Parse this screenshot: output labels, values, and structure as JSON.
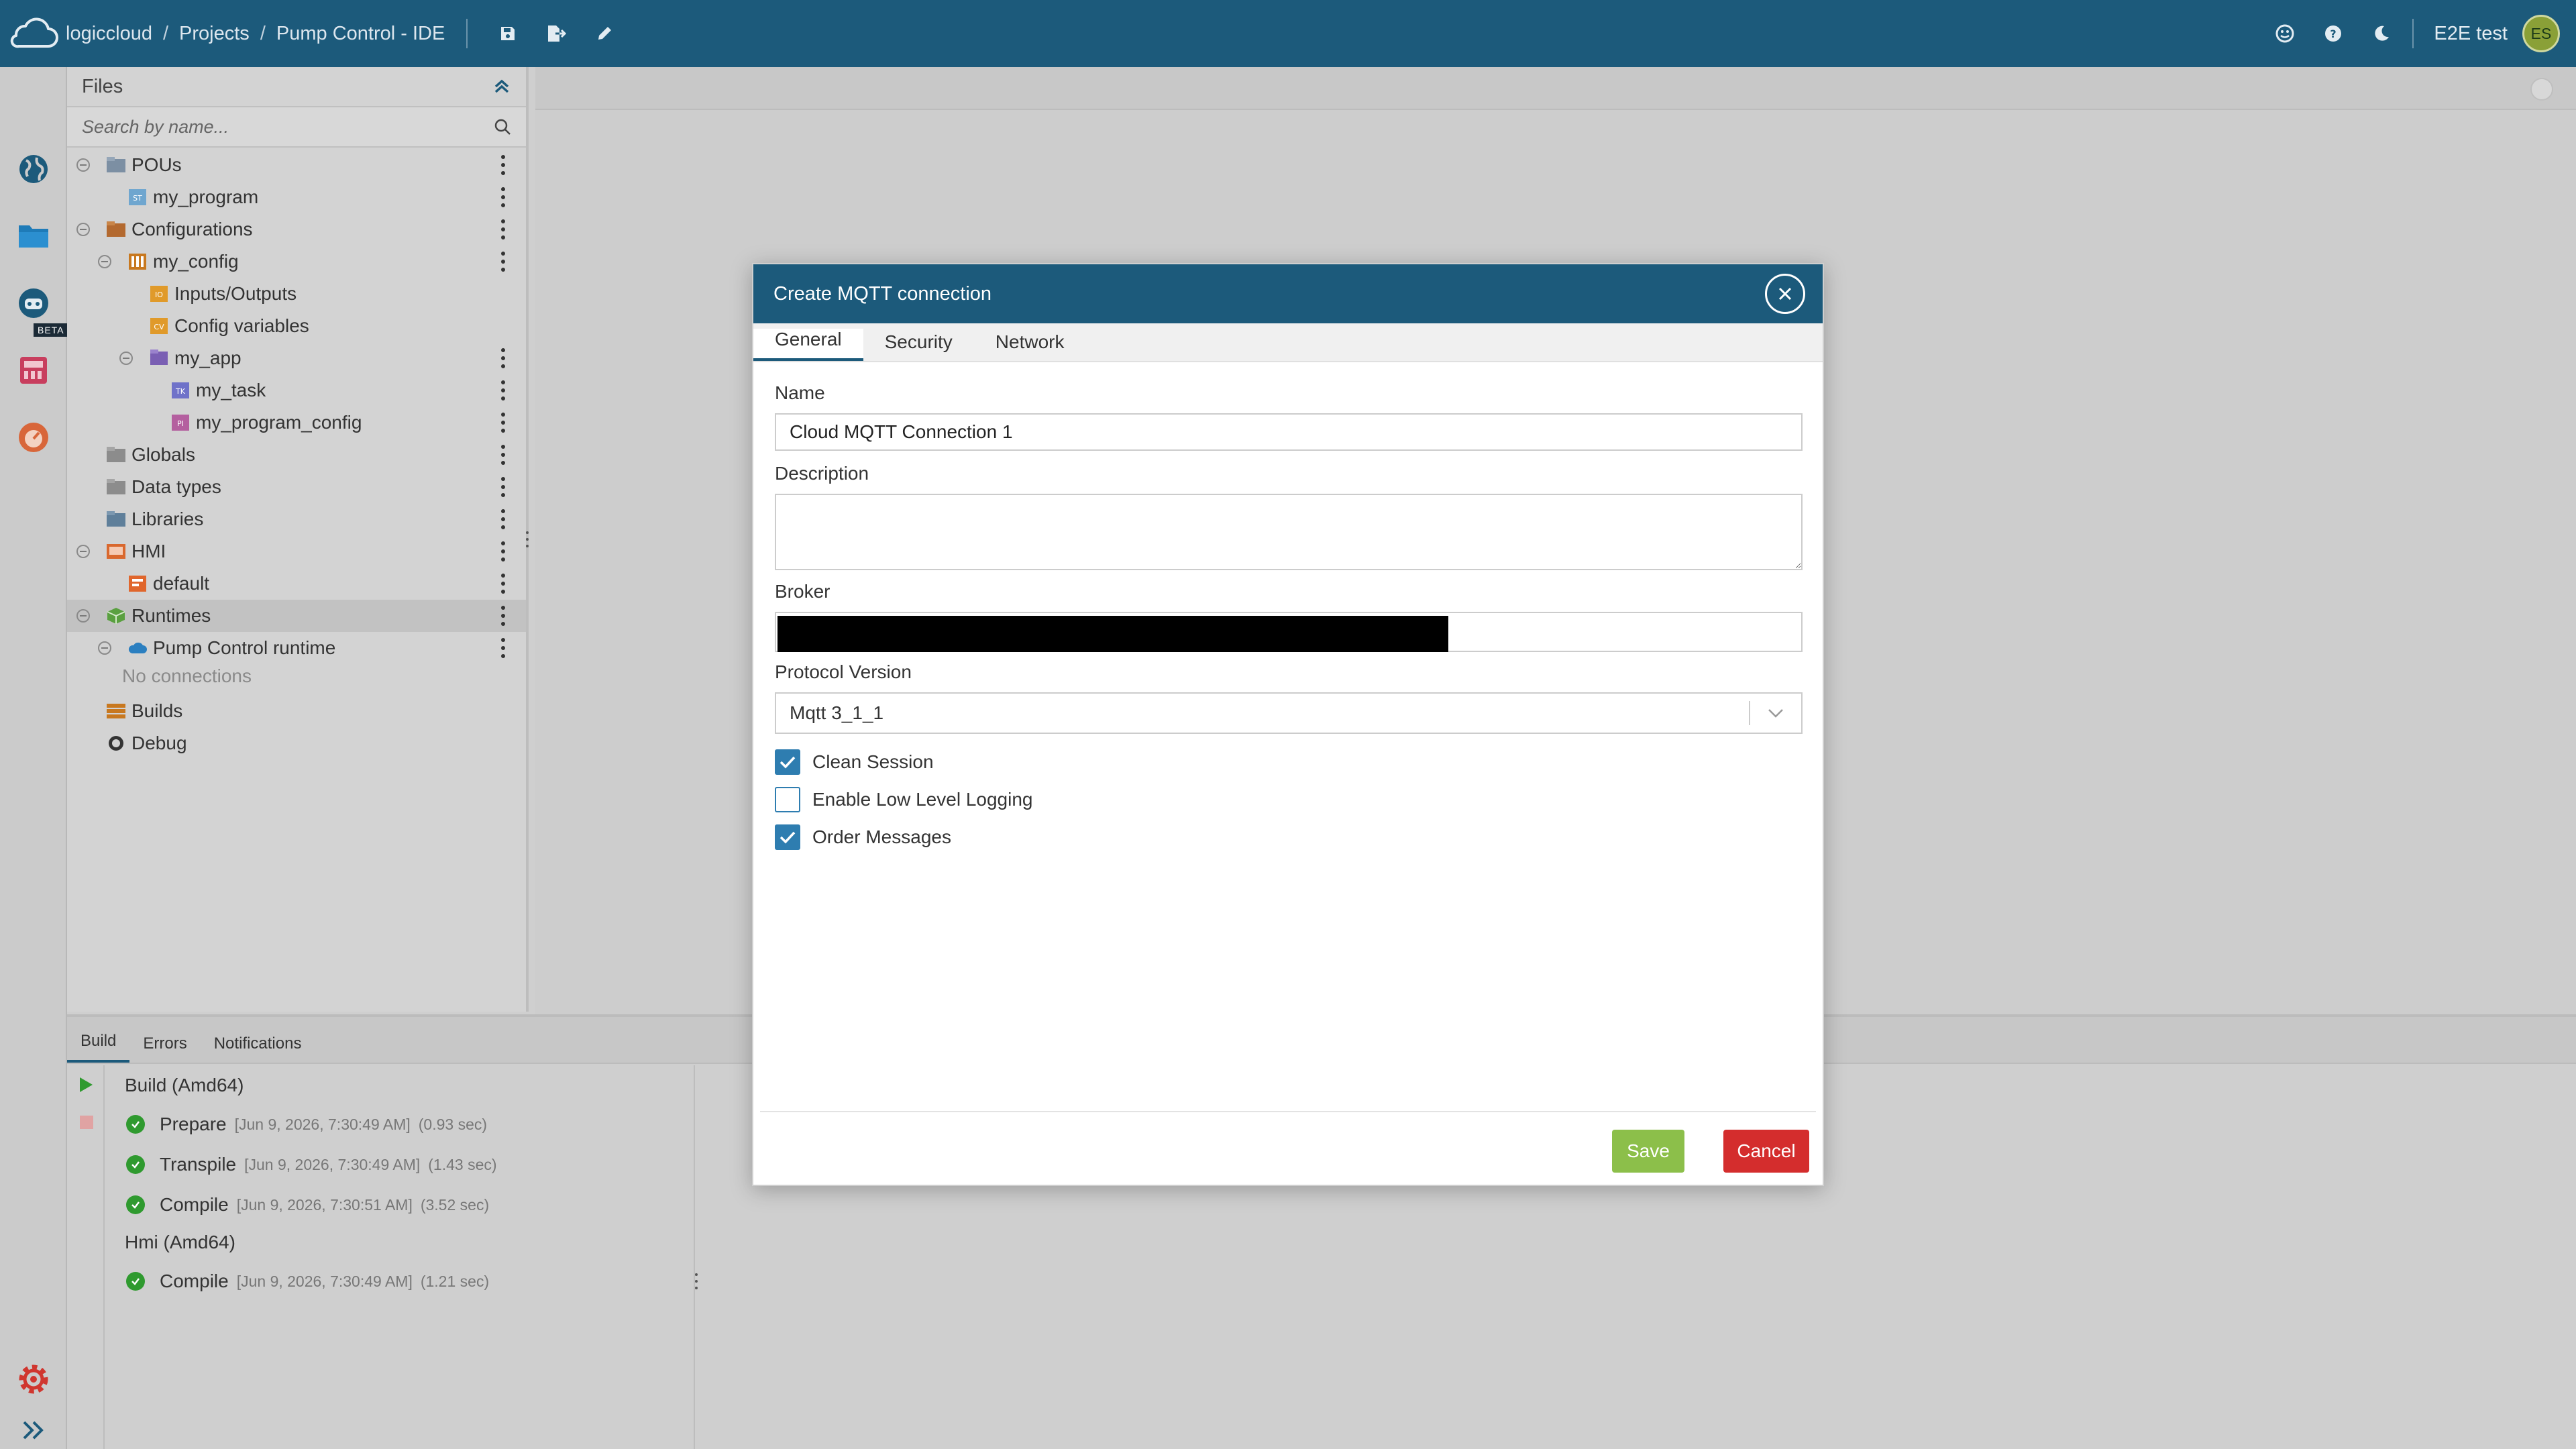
{
  "header": {
    "brand": "logiccloud",
    "crumbs": [
      "Projects",
      "Pump Control - IDE"
    ],
    "user_name": "E2E test",
    "user_initials": "ES",
    "brand_color": "#1c5a7b"
  },
  "rail": {
    "beta_badge": "BETA",
    "icons": [
      "globe-icon",
      "folder-icon",
      "robot-icon",
      "plc-device-icon",
      "gauge-icon",
      "settings-gear-icon",
      "expand-chevrons-icon"
    ]
  },
  "files": {
    "title": "Files",
    "search_placeholder": "Search by name...",
    "items": [
      {
        "label": "POUs"
      },
      {
        "label": "my_program"
      },
      {
        "label": "Configurations"
      },
      {
        "label": "my_config"
      },
      {
        "label": "Inputs/Outputs"
      },
      {
        "label": "Config variables"
      },
      {
        "label": "my_app"
      },
      {
        "label": "my_task"
      },
      {
        "label": "my_program_config"
      },
      {
        "label": "Globals"
      },
      {
        "label": "Data types"
      },
      {
        "label": "Libraries"
      },
      {
        "label": "HMI"
      },
      {
        "label": "default"
      },
      {
        "label": "Runtimes"
      },
      {
        "label": "Pump Control runtime"
      },
      {
        "label": "No connections"
      },
      {
        "label": "Builds"
      },
      {
        "label": "Debug"
      }
    ]
  },
  "bottom": {
    "tabs": [
      "Build",
      "Errors",
      "Notifications"
    ],
    "groups": [
      {
        "title": "Build (Amd64)",
        "steps": [
          {
            "name": "Prepare",
            "time": "[Jun 9, 2026, 7:30:49 AM]",
            "duration": "(0.93 sec)"
          },
          {
            "name": "Transpile",
            "time": "[Jun 9, 2026, 7:30:49 AM]",
            "duration": "(1.43 sec)"
          },
          {
            "name": "Compile",
            "time": "[Jun 9, 2026, 7:30:51 AM]",
            "duration": "(3.52 sec)"
          }
        ]
      },
      {
        "title": "Hmi (Amd64)",
        "steps": [
          {
            "name": "Compile",
            "time": "[Jun 9, 2026, 7:30:49 AM]",
            "duration": "(1.21 sec)"
          }
        ]
      }
    ]
  },
  "modal": {
    "title": "Create MQTT connection",
    "tabs": [
      "General",
      "Security",
      "Network"
    ],
    "name_label": "Name",
    "name_value": "Cloud MQTT Connection 1",
    "description_label": "Description",
    "description_value": "",
    "broker_label": "Broker",
    "broker_value": "",
    "protocol_label": "Protocol Version",
    "protocol_value": "Mqtt 3_1_1",
    "checkboxes": [
      {
        "label": "Clean Session",
        "checked": true
      },
      {
        "label": "Enable Low Level Logging",
        "checked": false
      },
      {
        "label": "Order Messages",
        "checked": true
      }
    ],
    "save_label": "Save",
    "cancel_label": "Cancel",
    "save_color": "#8cbf4a",
    "cancel_color": "#d42d2d"
  }
}
